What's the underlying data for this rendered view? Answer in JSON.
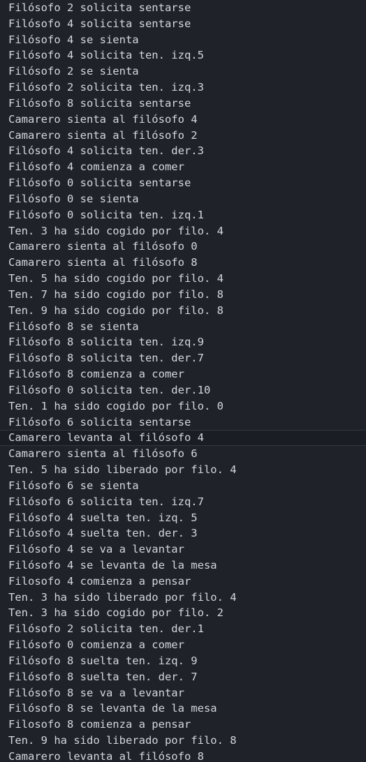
{
  "output": {
    "lines": [
      "Filósofo 2 solicita sentarse",
      "Filósofo 4 solicita sentarse",
      "Filósofo 4 se sienta",
      "Filósofo 4 solicita ten. izq.5",
      "Filósofo 2 se sienta",
      "Filósofo 2 solicita ten. izq.3",
      "Filósofo 8 solicita sentarse",
      "Camarero sienta al filósofo 4",
      "Camarero sienta al filósofo 2",
      "Filósofo 4 solicita ten. der.3",
      "Filósofo 4 comienza a comer",
      "Filósofo 0 solicita sentarse",
      "Filósofo 0 se sienta",
      "Filósofo 0 solicita ten. izq.1",
      "Ten. 3 ha sido cogido por filo. 4",
      "Camarero sienta al filósofo 0",
      "Camarero sienta al filósofo 8",
      "Ten. 5 ha sido cogido por filo. 4",
      "Ten. 7 ha sido cogido por filo. 8",
      "Ten. 9 ha sido cogido por filo. 8",
      "Filósofo 8 se sienta",
      "Filósofo 8 solicita ten. izq.9",
      "Filósofo 8 solicita ten. der.7",
      "Filósofo 8 comienza a comer",
      "Filósofo 0 solicita ten. der.10",
      "Ten. 1 ha sido cogido por filo. 0",
      "Filósofo 6 solicita sentarse",
      "Camarero levanta al filósofo 4",
      "Camarero sienta al filósofo 6",
      "Ten. 5 ha sido liberado por filo. 4",
      "Filósofo 6 se sienta",
      "Filósofo 6 solicita ten. izq.7",
      "Filósofo 4 suelta ten. izq. 5",
      "Filósofo 4 suelta ten. der. 3",
      "Filósofo 4 se va a levantar",
      "Filósofo 4 se levanta de la mesa",
      "Filosofo 4 comienza a pensar",
      "Ten. 3 ha sido liberado por filo. 4",
      "Ten. 3 ha sido cogido por filo. 2",
      "Filósofo 2 solicita ten. der.1",
      "Filósofo 0 comienza a comer",
      "Filósofo 8 suelta ten. izq. 9",
      "Filósofo 8 suelta ten. der. 7",
      "Filósofo 8 se va a levantar",
      "Filósofo 8 se levanta de la mesa",
      "Filosofo 8 comienza a pensar",
      "Ten. 9 ha sido liberado por filo. 8",
      "Camarero levanta al filósofo 8"
    ],
    "highlighted_line_index": 27
  }
}
